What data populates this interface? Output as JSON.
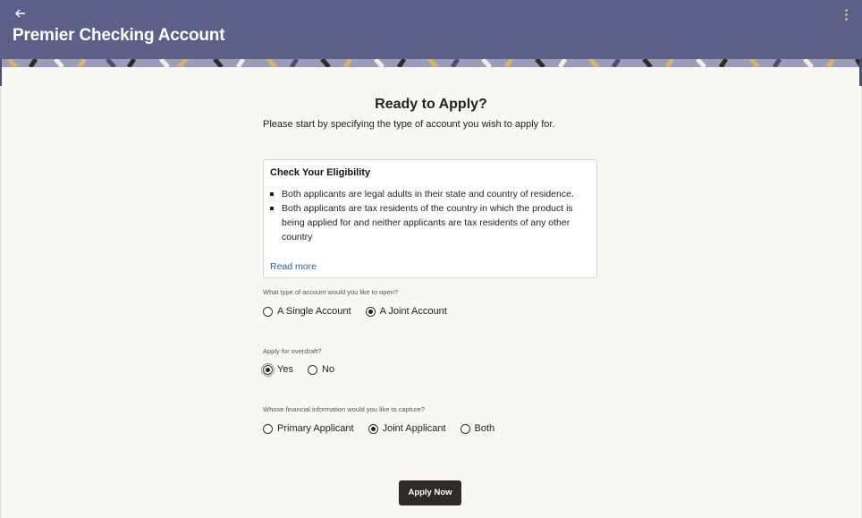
{
  "header": {
    "title": "Premier Checking Account",
    "back_icon": "arrow-left-icon",
    "menu_icon": "kebab-menu-icon",
    "colors": {
      "header_bg": "#5b5f8a",
      "accent": "#d9b36b"
    }
  },
  "main": {
    "title": "Ready to Apply?",
    "subtitle": "Please start by specifying the type of account you wish to apply for."
  },
  "eligibility": {
    "title": "Check Your Eligibility",
    "items": [
      "Both applicants are legal adults in their state and country of residence.",
      "Both applicants are tax residents of the country in which the product is being applied for and neither applicants are tax residents of any other country"
    ],
    "read_more": "Read more"
  },
  "questions": {
    "account_type": {
      "label": "What type of account would you like to open?",
      "options": [
        "A Single Account",
        "A Joint Account"
      ],
      "selected": "A Joint Account"
    },
    "overdraft": {
      "label": "Apply for overdraft?",
      "options": [
        "Yes",
        "No"
      ],
      "selected": "Yes"
    },
    "financial_info": {
      "label": "Whose financial information would you like to capture?",
      "options": [
        "Primary Applicant",
        "Joint Applicant",
        "Both"
      ],
      "selected": "Joint Applicant"
    }
  },
  "actions": {
    "apply_label": "Apply Now"
  }
}
